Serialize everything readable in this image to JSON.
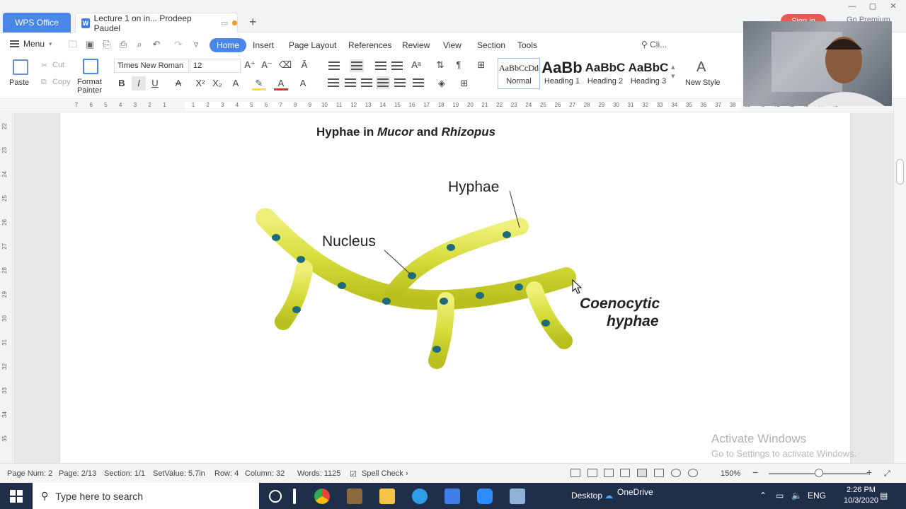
{
  "titlebar": {
    "app_tab": "WPS Office",
    "doc_tab": "Lecture 1 on in... Prodeep Paudel",
    "new_tab": "+",
    "sign_in": "Sign in",
    "premium": "Go Premium"
  },
  "menubar": {
    "menu_label": "Menu",
    "tabs": [
      "Home",
      "Insert",
      "Page Layout",
      "References",
      "Review",
      "View",
      "Section",
      "Tools"
    ],
    "active_tab": "Home",
    "search_label": "Cli..."
  },
  "ribbon": {
    "paste": "Paste",
    "cut": "Cut",
    "copy": "Copy",
    "format_painter_1": "Format",
    "format_painter_2": "Painter",
    "font_name": "Times New Roman",
    "font_size": "12",
    "styles": [
      {
        "preview": "AaBbCcDd",
        "name": "Normal"
      },
      {
        "preview": "AaBb",
        "name": "Heading 1"
      },
      {
        "preview": "AaBbC",
        "name": "Heading 2"
      },
      {
        "preview": "AaBbC",
        "name": "Heading 3"
      }
    ],
    "new_style": "New Style",
    "colors": {
      "accent": "#4a86e8",
      "highlight": "#f5e23b",
      "font_color": "#e03030"
    }
  },
  "ruler": {
    "left_numbers": [
      "7",
      "6",
      "5",
      "4",
      "3",
      "2",
      "1"
    ],
    "right_numbers": [
      "1",
      "2",
      "3",
      "4",
      "5",
      "6",
      "7",
      "8",
      "9",
      "10",
      "11",
      "12",
      "13",
      "14",
      "15",
      "16",
      "17",
      "18",
      "19",
      "20",
      "21",
      "22",
      "23",
      "24",
      "25",
      "26",
      "27",
      "28",
      "29",
      "30",
      "31",
      "32",
      "33",
      "34",
      "35",
      "36",
      "37",
      "38",
      "39",
      "40",
      "41",
      "42",
      "43",
      "44",
      "45"
    ],
    "vertical_numbers": [
      "22",
      "23",
      "24",
      "25",
      "26",
      "27",
      "28",
      "29",
      "30",
      "31",
      "32",
      "33",
      "34",
      "35"
    ]
  },
  "document": {
    "title_prefix": "Hyphae in ",
    "title_italic_1": "Mucor",
    "title_middle": " and ",
    "title_italic_2": "Rhizopus",
    "figure": {
      "label_hyphae": "Hyphae",
      "label_nucleus": "Nucleus",
      "label_coenocytic_1": "Coenocytic",
      "label_coenocytic_2": "hyphae",
      "hypha_color": "#d6dc3a",
      "nucleus_color": "#1f6b7a"
    }
  },
  "statusbar": {
    "page_num": "Page Num: 2",
    "page": "Page: 2/13",
    "section": "Section: 1/1",
    "set_value": "SetValue: 5.7in",
    "row": "Row: 4",
    "column": "Column: 32",
    "words": "Words: 1125",
    "spell_check": "Spell Check",
    "zoom": "150%"
  },
  "watermark": {
    "line1": "Activate Windows",
    "line2": "Go to Settings to activate Windows."
  },
  "taskbar": {
    "search_placeholder": "Type here to search",
    "desktop": "Desktop",
    "onedrive": "OneDrive",
    "lang": "ENG",
    "time": "2:26 PM",
    "date": "10/3/2020"
  }
}
